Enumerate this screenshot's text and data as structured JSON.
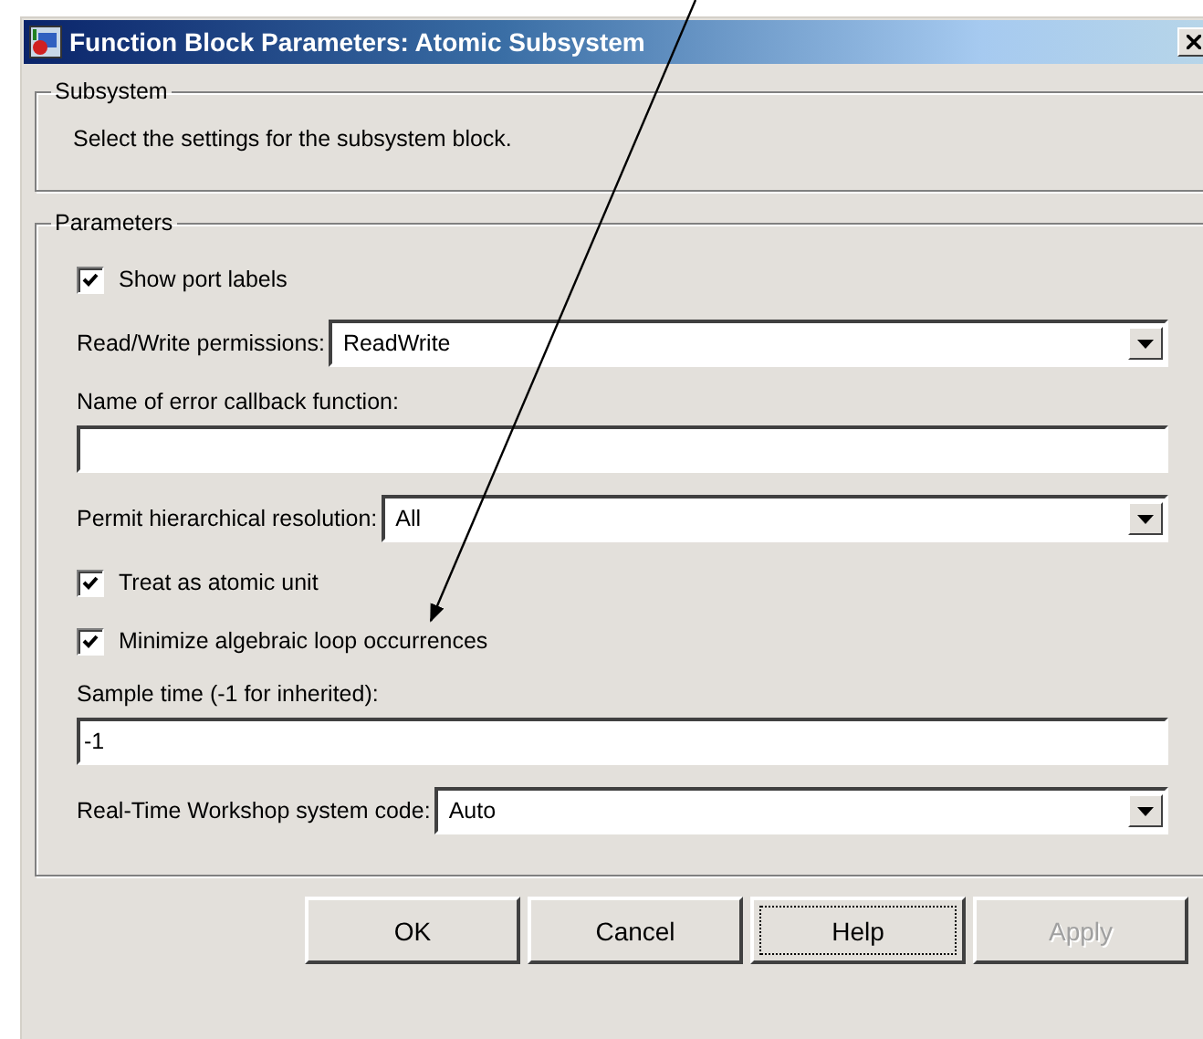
{
  "window": {
    "title": "Function Block Parameters: Atomic Subsystem"
  },
  "subsystem": {
    "legend": "Subsystem",
    "description": "Select the settings for the subsystem block."
  },
  "parameters": {
    "legend": "Parameters",
    "items": [
      {
        "kind": "checkbox",
        "label": "Show port labels",
        "checked": true
      },
      {
        "kind": "dropdown",
        "label": "Read/Write permissions:",
        "value": "ReadWrite"
      },
      {
        "kind": "text",
        "label": "Name of error callback function:"
      },
      {
        "kind": "dropdown",
        "label": "Permit hierarchical resolution:",
        "value": "All"
      },
      {
        "kind": "checkbox",
        "label": "Treat as atomic unit",
        "checked": true
      },
      {
        "kind": "checkbox",
        "label": "Minimize algebraic loop occurrences",
        "checked": true
      },
      {
        "kind": "text",
        "label": "Sample time (-1 for inherited):",
        "value": "-1"
      },
      {
        "kind": "dropdown",
        "label": "Real-Time Workshop system code:",
        "value": "Auto"
      }
    ]
  },
  "buttons": [
    {
      "label": "OK",
      "disabled": false,
      "focused": false
    },
    {
      "label": "Cancel",
      "disabled": false,
      "focused": false
    },
    {
      "label": "Help",
      "disabled": false,
      "focused": true
    },
    {
      "label": "Apply",
      "disabled": true,
      "focused": false
    }
  ]
}
